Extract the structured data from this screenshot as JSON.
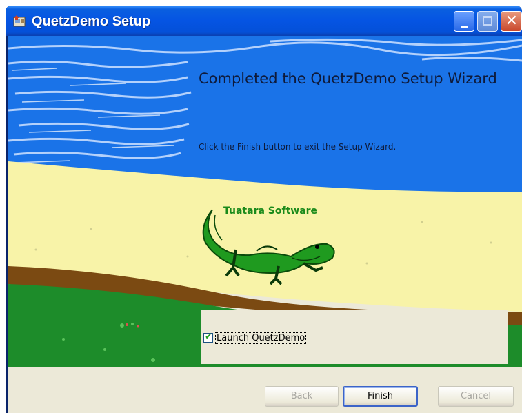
{
  "window": {
    "title": "QuetzDemo Setup",
    "app_icon": "installer-icon",
    "controls": [
      "minimize-icon",
      "maximize-icon",
      "close-icon"
    ]
  },
  "wizard": {
    "headline": "Completed the QuetzDemo Setup Wizard",
    "description": "Click the Finish button to exit the Setup Wizard.",
    "brand": "Tuatara Software",
    "banner_image": "tuatara-on-beach"
  },
  "launch": {
    "label": "Launch QuetzDemo",
    "checked": true
  },
  "buttons": {
    "back": "Back",
    "finish": "Finish",
    "cancel": "Cancel"
  },
  "colors": {
    "sky": "#1a73e8",
    "sand": "#f8f3a8",
    "soil": "#7b4a12",
    "grass": "#1d8c2a",
    "titlebar": "#0554e3",
    "dialog": "#ece9d8"
  }
}
